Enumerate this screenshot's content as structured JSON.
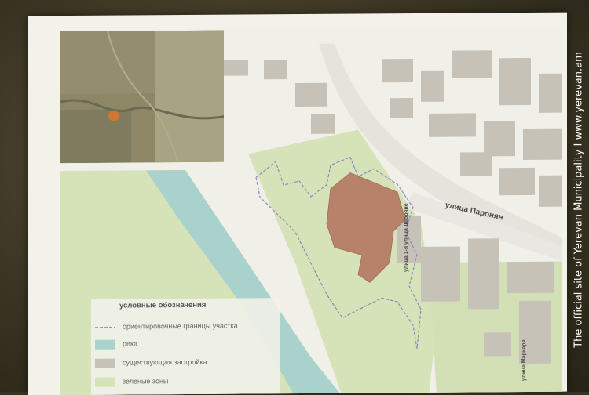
{
  "legend": {
    "title": "условные обозначения",
    "items": [
      {
        "label": "ориентировочные границы участка",
        "swatch": "boundary-line",
        "color": "#8a8ab8"
      },
      {
        "label": "река",
        "swatch": "fill",
        "color": "#a9d2cc"
      },
      {
        "label": "существующая застройка",
        "swatch": "fill",
        "color": "#c7c2b8"
      },
      {
        "label": "зеленые зоны",
        "swatch": "fill",
        "color": "#d6e2b8"
      }
    ]
  },
  "streets": {
    "paronyan": "улица Паронян",
    "dvoryan": "улица 1-я улица Дворяне",
    "markazyan": "улица Маркаря"
  },
  "watermark": "The official site of Yerevan Municipality  I  www.yerevan.am",
  "colors": {
    "river": "#a9d2cc",
    "green_zone": "#d6e2b8",
    "buildings": "#c7c2b8",
    "project_site": "#b8826a",
    "screen_bg": "#f2f1ea"
  }
}
